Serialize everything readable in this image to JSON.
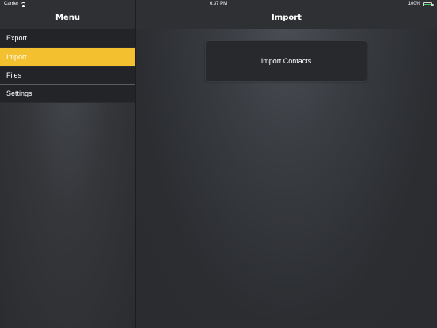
{
  "status_bar": {
    "carrier": "Carrier",
    "time": "6:37 PM",
    "battery": "100%"
  },
  "sidebar": {
    "title": "Menu",
    "items": [
      {
        "label": "Export"
      },
      {
        "label": "Import"
      },
      {
        "label": "Files"
      },
      {
        "label": "Settings"
      }
    ],
    "active_index": 1
  },
  "main": {
    "title": "Import",
    "import_button_label": "Import Contacts"
  },
  "colors": {
    "accent": "#f3c02f",
    "background": "#2b2d31",
    "battery": "#41d05b"
  }
}
